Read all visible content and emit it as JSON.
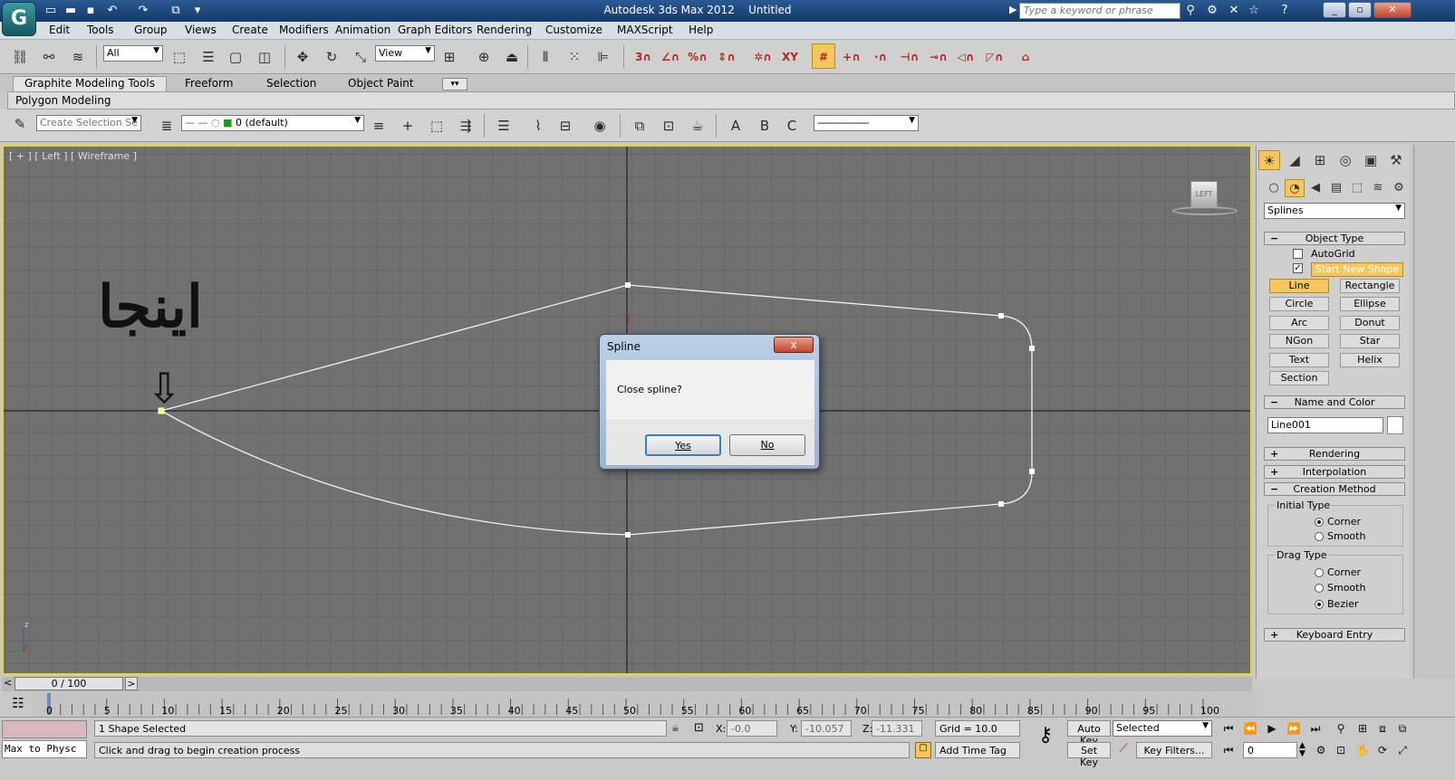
{
  "window": {
    "title": "Autodesk 3ds Max 2012",
    "document": "Untitled",
    "search_placeholder": "Type a keyword or phrase",
    "logo": "G"
  },
  "menu": [
    "Edit",
    "Tools",
    "Group",
    "Views",
    "Create",
    "Modifiers",
    "Animation",
    "Graph Editors",
    "Rendering",
    "Customize",
    "MAXScript",
    "Help"
  ],
  "toolbar": {
    "selection_filter": "All",
    "reference_coord": "View"
  },
  "ribbon": {
    "tabs": [
      "Graphite Modeling Tools",
      "Freeform",
      "Selection",
      "Object Paint"
    ],
    "panel": "Polygon Modeling"
  },
  "toolbar2": {
    "selection_set_placeholder": "Create Selection Se",
    "layer": "0 (default)"
  },
  "viewport": {
    "label": "[ + ] [ Left ] [ Wireframe ]",
    "annotation_text": "اینجا",
    "viewcube_label": "LEFT",
    "axis_z": "z"
  },
  "dialog": {
    "title": "Spline",
    "message": "Close spline?",
    "yes": "Yes",
    "no": "No",
    "close": "x"
  },
  "command_panel": {
    "category": "Splines",
    "object_type_title": "Object Type",
    "autogrid": "AutoGrid",
    "start_new_shape": "Start New Shape",
    "buttons": [
      "Line",
      "Rectangle",
      "Circle",
      "Ellipse",
      "Arc",
      "Donut",
      "NGon",
      "Star",
      "Text",
      "Helix",
      "Section"
    ],
    "active_button": "Line",
    "name_color_title": "Name and Color",
    "object_name": "Line001",
    "rendering_title": "Rendering",
    "interpolation_title": "Interpolation",
    "creation_method_title": "Creation Method",
    "initial_type": "Initial Type",
    "initial_options": [
      "Corner",
      "Smooth"
    ],
    "initial_selected": "Corner",
    "drag_type": "Drag Type",
    "drag_options": [
      "Corner",
      "Smooth",
      "Bezier"
    ],
    "drag_selected": "Bezier",
    "keyboard_entry_title": "Keyboard Entry"
  },
  "timeline": {
    "frame_display": "0 / 100",
    "ticks": [
      "0",
      "5",
      "10",
      "15",
      "20",
      "25",
      "30",
      "35",
      "40",
      "45",
      "50",
      "55",
      "60",
      "65",
      "70",
      "75",
      "80",
      "85",
      "90",
      "95",
      "100"
    ]
  },
  "status": {
    "selection": "1 Shape Selected",
    "prompt": "Click and drag to begin creation process",
    "script_listener": "Max to Physc",
    "x_label": "X:",
    "x_value": "-0.0",
    "y_label": "Y:",
    "y_value": "-10.057",
    "z_label": "Z:",
    "z_value": "-11.331",
    "grid": "Grid = 10.0",
    "add_time_tag": "Add Time Tag",
    "auto_key": "Auto Key",
    "set_key": "Set Key",
    "key_mode": "Selected",
    "key_filters": "Key Filters...",
    "current_frame": "0"
  }
}
